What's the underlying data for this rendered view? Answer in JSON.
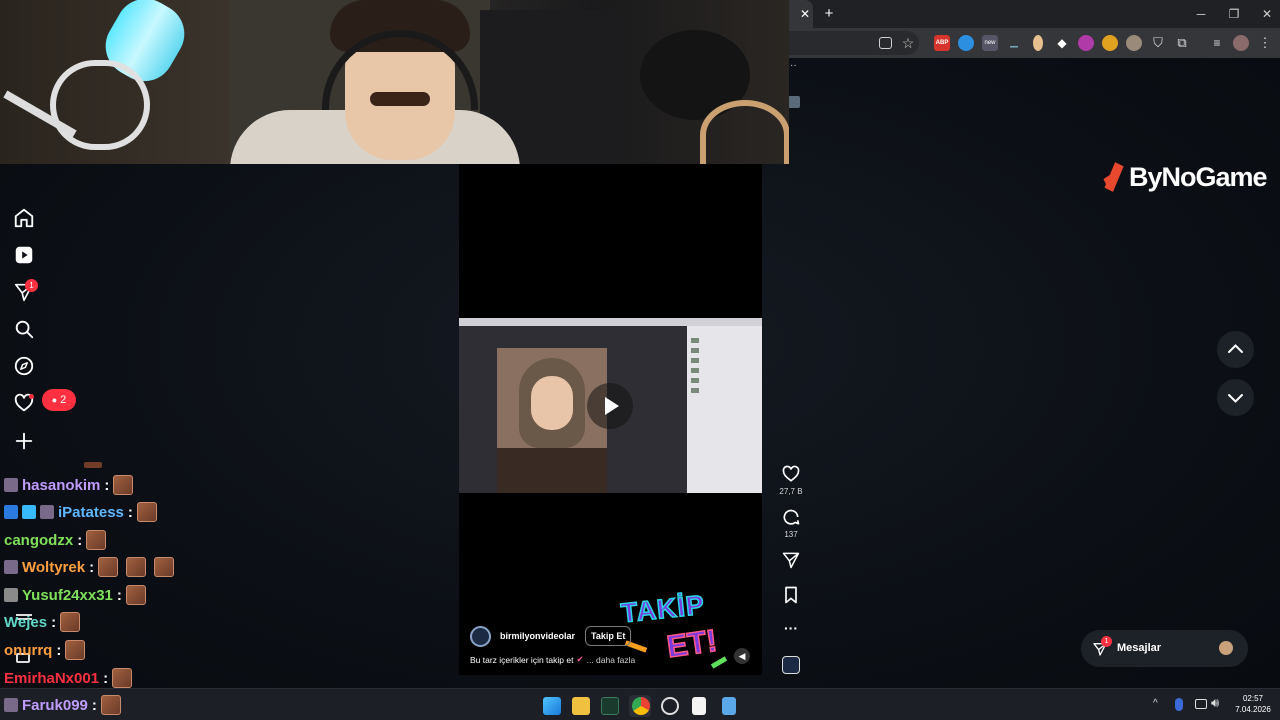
{
  "browser": {
    "tab_close": "✕",
    "new_tab": "+",
    "window_minimize": "─",
    "window_maximize": "❐",
    "window_close": "✕",
    "toolbar_icons": [
      "install-icon",
      "star-icon",
      "adblock-icon",
      "extension-icon",
      "extension-icon",
      "extension-icon",
      "extension-icon",
      "extension-icon",
      "extension-icon",
      "extension-icon",
      "shield-icon",
      "puzzle-icon",
      "media-icon",
      "profile-icon",
      "menu-icon"
    ],
    "abp_label": "ABP",
    "new_badge": "new"
  },
  "brand": {
    "logo_text": "ByNoGame",
    "accent_color": "#e8492e"
  },
  "nav": {
    "notifications_count": "1",
    "followers_badge_count": "2"
  },
  "chat": {
    "messages": [
      {
        "user": "hasanokim",
        "color": "#c09cff",
        "emotes": 1
      },
      {
        "user": "iPatatess",
        "color": "#5fb8ff",
        "emotes": 1
      },
      {
        "user": "cangodzx",
        "color": "#7fe05a",
        "emotes": 1
      },
      {
        "user": "Woltyrek",
        "color": "#ff9f40",
        "emotes": 3
      },
      {
        "user": "Yusuf24xx31",
        "color": "#7fe05a",
        "emotes": 1
      },
      {
        "user": "Wejes",
        "color": "#5fd8c8",
        "emotes": 1
      },
      {
        "user": "onurrq",
        "color": "#ff9f40",
        "emotes": 1
      },
      {
        "user": "EmirhaNx001",
        "color": "#ff3040",
        "emotes": 1
      },
      {
        "user": "Faruk099",
        "color": "#c09cff",
        "emotes": 1
      }
    ],
    "separator": ":"
  },
  "reel": {
    "account": "birmilyonvideolar",
    "follow_button": "Takip Et",
    "caption": "Bu tarz içerikler için takip et",
    "more": "... daha fazla",
    "sticker_text_1": "TAKİP",
    "sticker_text_2": "ET!",
    "likes": "27,7 B",
    "comments": "137"
  },
  "messages_pill": {
    "label": "Mesajlar",
    "badge": "1"
  },
  "taskbar": {
    "time": "02:57",
    "date": "7.04.2026"
  }
}
